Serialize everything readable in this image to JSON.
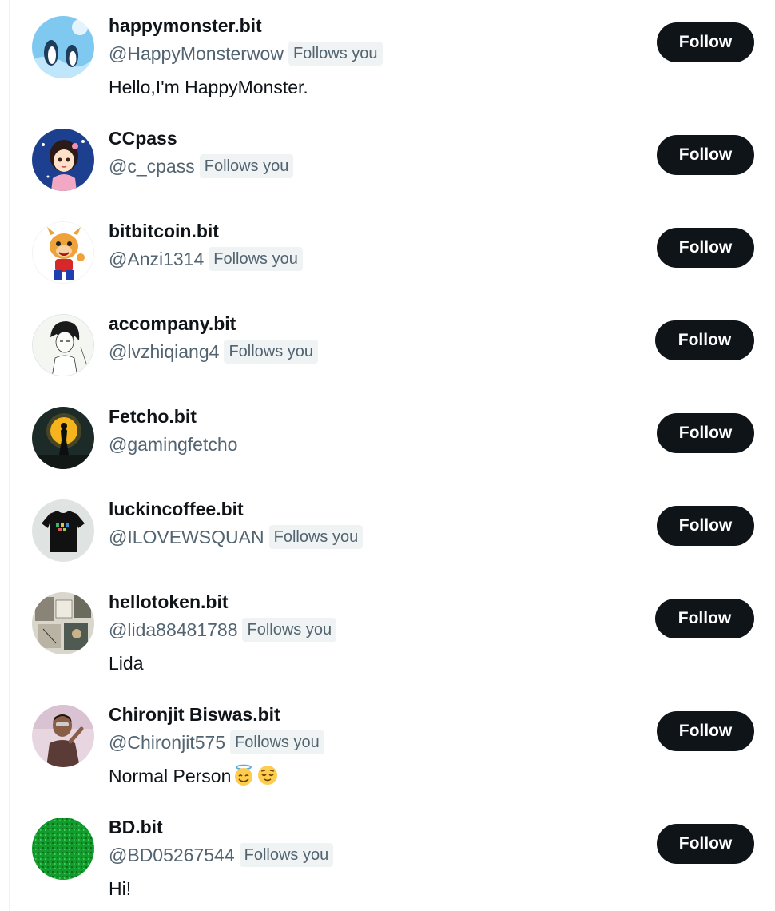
{
  "follow_label": "Follow",
  "follows_you_label": "Follows you",
  "users": [
    {
      "name": "happymonster.bit",
      "handle": "@HappyMonsterwow",
      "bio": "Hello,I'm HappyMonster.",
      "avatar": "penguin-avatar"
    },
    {
      "name": "CCpass",
      "handle": "@c_cpass",
      "avatar": "anime-girl-avatar"
    },
    {
      "name": "bitbitcoin.bit",
      "handle": "@Anzi1314",
      "avatar": "cartoon-cow-avatar"
    },
    {
      "name": "accompany.bit",
      "handle": "@lvzhiqiang4",
      "avatar": "sketch-person-avatar"
    },
    {
      "name": "Fetcho.bit",
      "handle": "@gamingfetcho",
      "avatar": "moon-silhouette-avatar"
    },
    {
      "name": "luckincoffee.bit",
      "handle": "@ILOVEWSQUAN",
      "avatar": "tshirt-avatar"
    },
    {
      "name": "hellotoken.bit",
      "handle": "@lida88481788",
      "bio": "Lida",
      "avatar": "collage-avatar"
    },
    {
      "name": "Chironjit Biswas.bit",
      "handle": "@Chironjit575",
      "bio": "Normal Person",
      "avatar": "person-photo-avatar"
    },
    {
      "name": "BD.bit",
      "handle": "@BD05267544",
      "bio": "Hi!",
      "avatar": "green-pattern-avatar"
    }
  ]
}
